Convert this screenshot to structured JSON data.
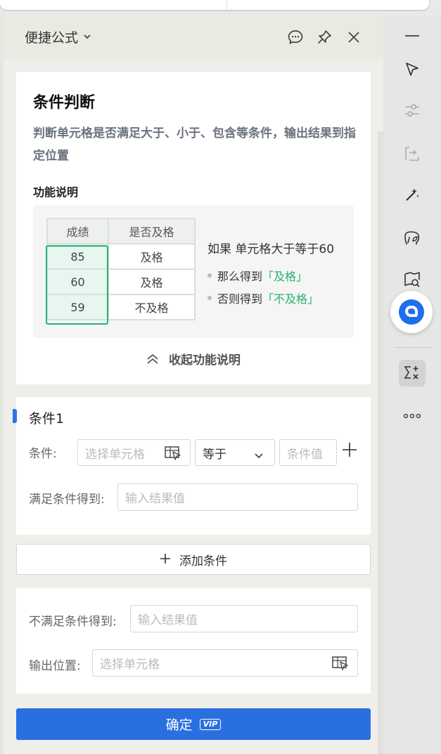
{
  "panel": {
    "title": "便捷公式"
  },
  "info_card": {
    "title": "条件判断",
    "description": "判断单元格是否满足大于、小于、包含等条件，输出结果到指定位置",
    "section_label": "功能说明",
    "demo_table": {
      "headers": [
        "成绩",
        "是否及格"
      ],
      "rows": [
        [
          "85",
          "及格"
        ],
        [
          "60",
          "及格"
        ],
        [
          "59",
          "不及格"
        ]
      ]
    },
    "rule_text": "如果 单元格大于等于60",
    "then_prefix": "那么得到",
    "then_value": "「及格」",
    "else_prefix": "否则得到",
    "else_value": "「不及格」",
    "collapse_label": "收起功能说明"
  },
  "condition": {
    "title": "条件1",
    "condition_label": "条件:",
    "cell_placeholder": "选择单元格",
    "operator_value": "等于",
    "value_placeholder": "条件值",
    "result_label": "满足条件得到:",
    "result_placeholder": "输入结果值"
  },
  "add_condition_label": "添加条件",
  "else_section": {
    "else_label": "不满足条件得到:",
    "else_placeholder": "输入结果值",
    "output_label": "输出位置:",
    "output_placeholder": "选择单元格"
  },
  "confirm": {
    "label": "确定",
    "badge": "VIP"
  },
  "colors": {
    "accent": "#2a6fe0",
    "green": "#26b374"
  }
}
